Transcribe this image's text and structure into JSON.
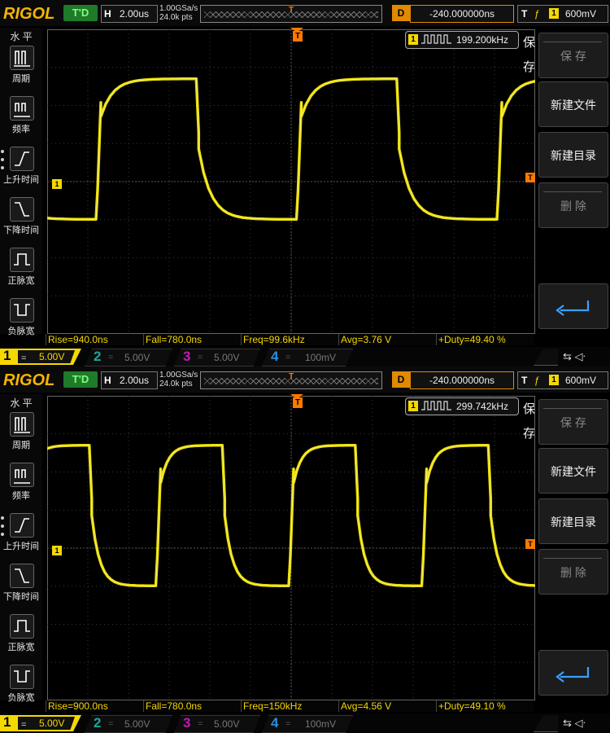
{
  "screens": [
    {
      "header": {
        "logo": "RIGOL",
        "trigger_status": "T'D",
        "timebase_label": "H",
        "timebase": "2.00us",
        "sample_rate": "1.00GSa/s",
        "mem_depth": "24.0k pts",
        "delay_label": "D",
        "delay": "-240.000000ns",
        "trigger_label": "T",
        "trigger_channel": "1",
        "trigger_level": "600mV"
      },
      "left_menu": {
        "title": "水 平",
        "items": [
          "周期",
          "频率",
          "上升时间",
          "下降时间",
          "正脉宽",
          "负脉宽"
        ]
      },
      "freq_counter": {
        "channel": "1",
        "value": "199.200kHz"
      },
      "right_menu": {
        "title": "保存",
        "buttons": [
          "保 存",
          "新建文件",
          "新建目录",
          "删 除"
        ]
      },
      "measurements": [
        "Rise=940.0ns",
        "Fall=780.0ns",
        "Freq=99.6kHz",
        "Avg=3.76 V",
        "+Duty=49.40 %"
      ],
      "channels": [
        {
          "num": "1",
          "coupling": "=",
          "scale": "5.00V"
        },
        {
          "num": "2",
          "coupling": "=",
          "scale": "5.00V"
        },
        {
          "num": "3",
          "coupling": "=",
          "scale": "5.00V"
        },
        {
          "num": "4",
          "coupling": "=",
          "scale": "100mV"
        }
      ],
      "waveform": {
        "color": "#f5e800",
        "period_divs": 4.93,
        "phase_div": 1.2,
        "high_level_div": 1.5,
        "low_level_div": -0.55
      }
    },
    {
      "header": {
        "logo": "RIGOL",
        "trigger_status": "T'D",
        "timebase_label": "H",
        "timebase": "2.00us",
        "sample_rate": "1.00GSa/s",
        "mem_depth": "24.0k pts",
        "delay_label": "D",
        "delay": "-240.000000ns",
        "trigger_label": "T",
        "trigger_channel": "1",
        "trigger_level": "600mV"
      },
      "left_menu": {
        "title": "水 平",
        "items": [
          "周期",
          "频率",
          "上升时间",
          "下降时间",
          "正脉宽",
          "负脉宽"
        ]
      },
      "freq_counter": {
        "channel": "1",
        "value": "299.742kHz"
      },
      "right_menu": {
        "title": "保存",
        "buttons": [
          "保 存",
          "新建文件",
          "新建目录",
          "删 除"
        ]
      },
      "measurements": [
        "Rise=900.0ns",
        "Fall=780.0ns",
        "Freq=150kHz",
        "Avg=4.56 V",
        "+Duty=49.10 %"
      ],
      "channels": [
        {
          "num": "1",
          "coupling": "=",
          "scale": "5.00V"
        },
        {
          "num": "2",
          "coupling": "=",
          "scale": "5.00V"
        },
        {
          "num": "3",
          "coupling": "=",
          "scale": "5.00V"
        },
        {
          "num": "4",
          "coupling": "=",
          "scale": "100mV"
        }
      ],
      "waveform": {
        "color": "#f5e800",
        "period_divs": 3.27,
        "phase_div": -0.6,
        "high_level_div": 1.5,
        "low_level_div": -0.55
      }
    }
  ]
}
